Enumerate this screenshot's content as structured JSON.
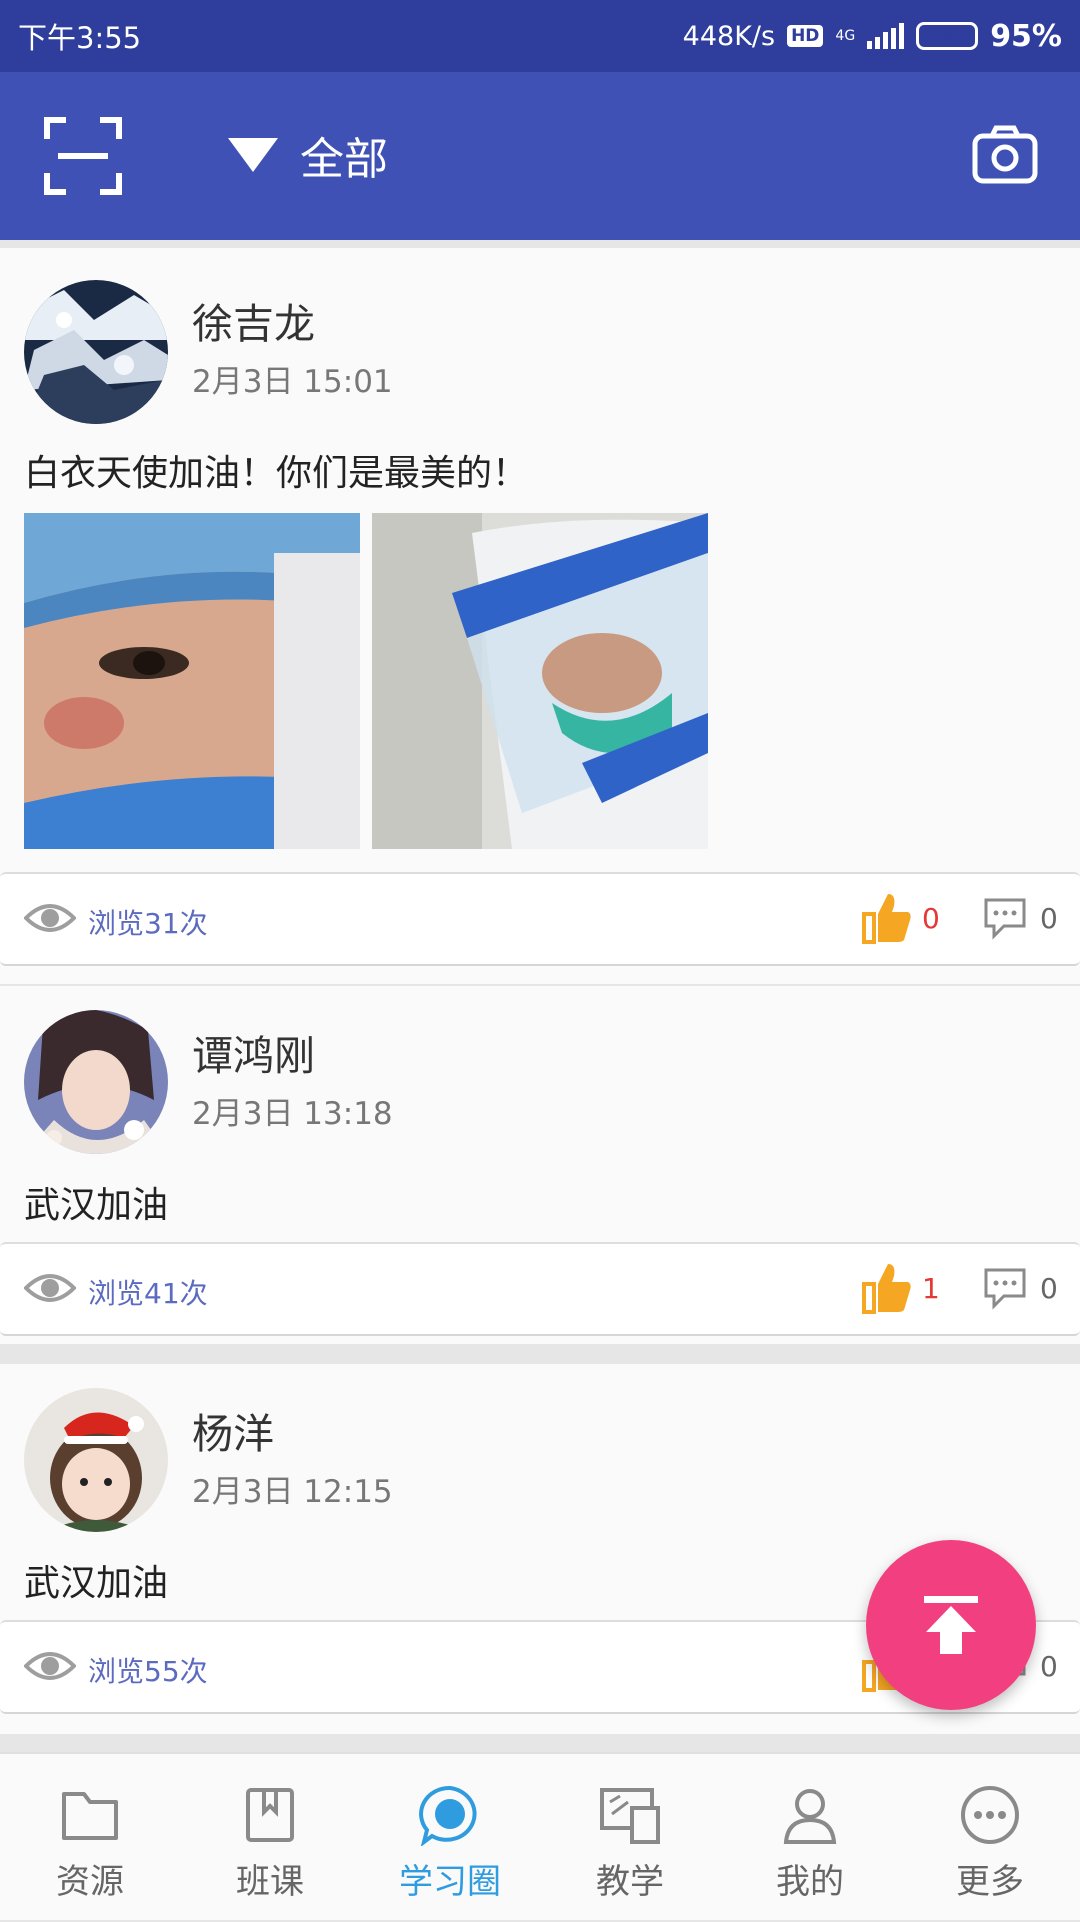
{
  "status_bar": {
    "time": "下午3:55",
    "net_speed": "448K/s",
    "hd": "HD",
    "network": "4G",
    "battery": "95%"
  },
  "header": {
    "filter_label": "全部",
    "scan_icon": "scan-icon",
    "camera_icon": "camera-icon",
    "accent": "#3f51b5"
  },
  "posts": [
    {
      "author": "徐吉龙",
      "time": "2月3日  15:01",
      "text": "白衣天使加油！你们是最美的！",
      "views": "浏览31次",
      "likes": "0",
      "comments": "0",
      "photos": [
        "nurse-face-photo",
        "medic-face-shield-photo"
      ]
    },
    {
      "author": "谭鸿刚",
      "time": "2月3日  13:18",
      "text": "武汉加油",
      "views": "浏览41次",
      "likes": "1",
      "comments": "0"
    },
    {
      "author": "杨洋",
      "time": "2月3日  12:15",
      "text": "武汉加油",
      "views": "浏览55次",
      "likes": "",
      "comments": "0"
    }
  ],
  "bottom_nav": {
    "items": [
      {
        "label": "资源",
        "icon": "folder-icon"
      },
      {
        "label": "班课",
        "icon": "book-icon"
      },
      {
        "label": "学习圈",
        "icon": "chat-bubble-icon",
        "active": true
      },
      {
        "label": "教学",
        "icon": "teaching-icon"
      },
      {
        "label": "我的",
        "icon": "person-icon"
      },
      {
        "label": "更多",
        "icon": "more-icon"
      }
    ],
    "active_color": "#2f9ce0"
  },
  "fab": {
    "icon": "scroll-top-icon",
    "color": "#f23f7f"
  }
}
